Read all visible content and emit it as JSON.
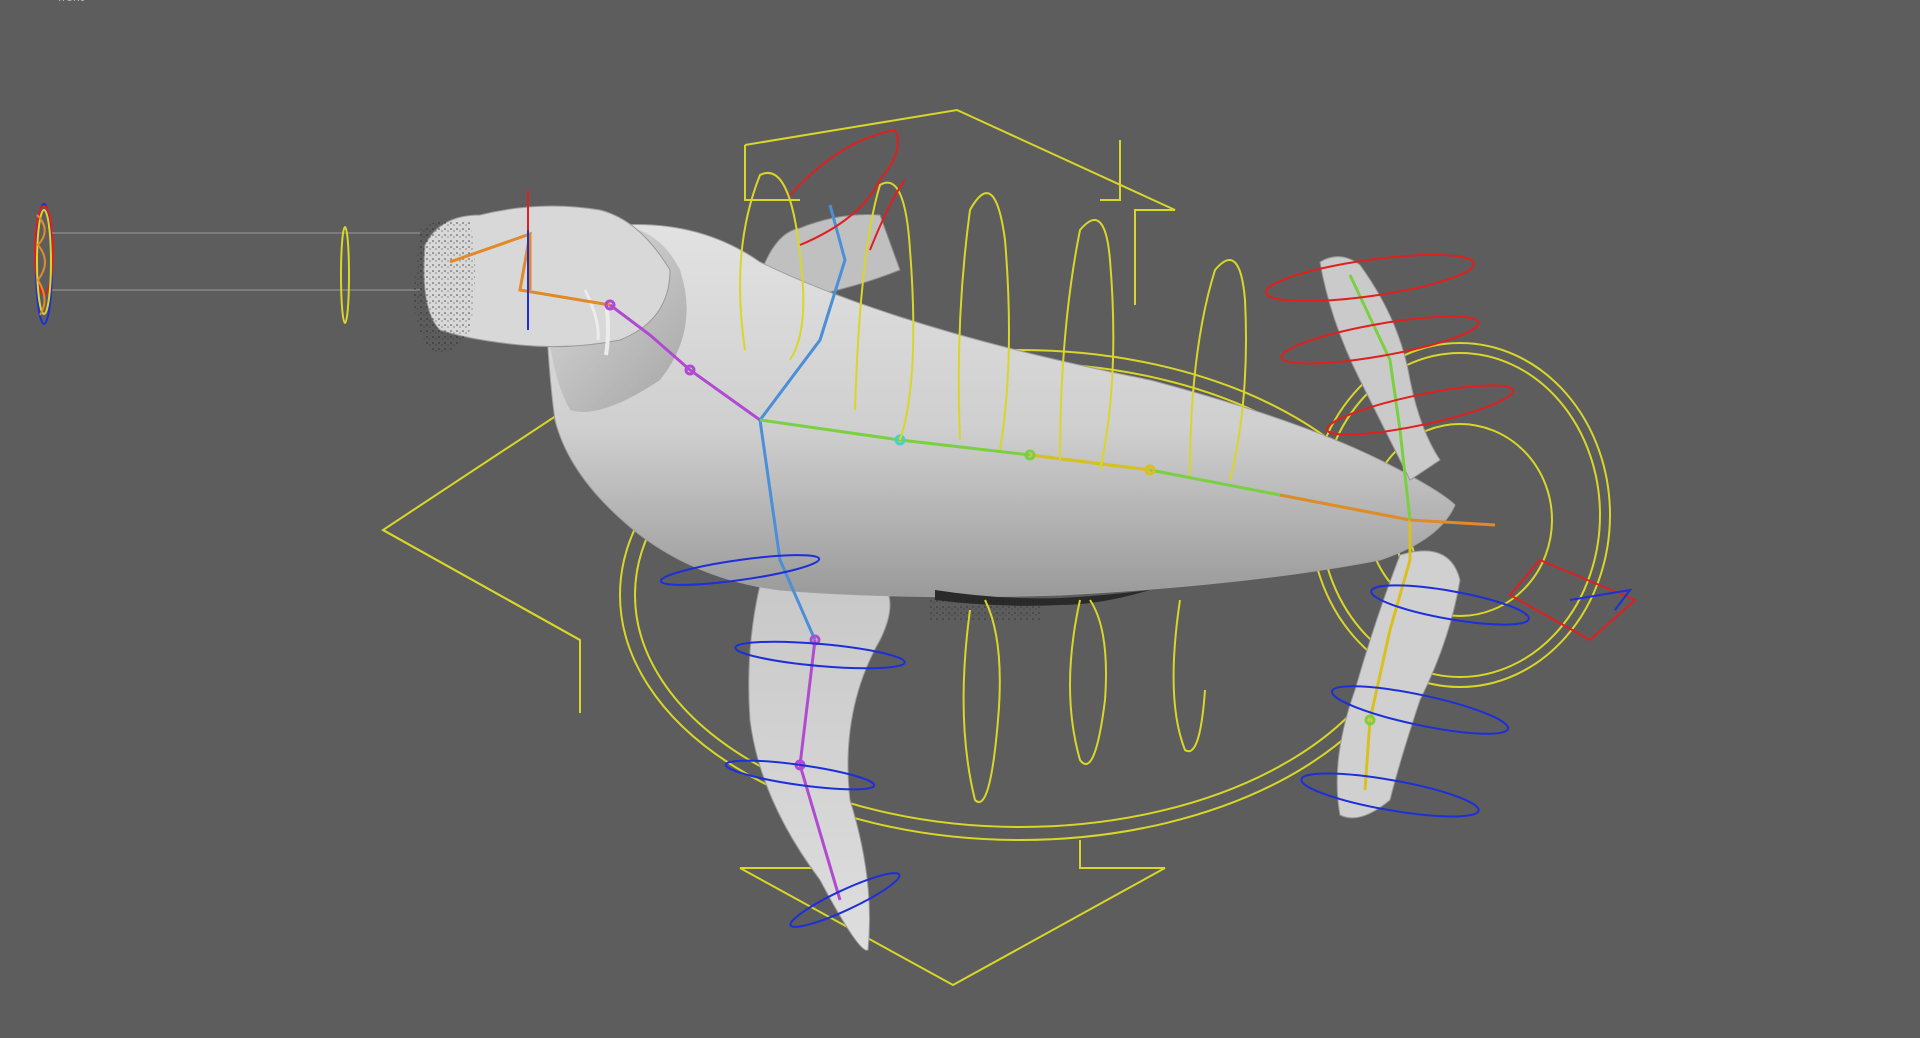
{
  "viewport": {
    "label": "front",
    "background": "#5d5d5d"
  },
  "colors": {
    "control_curve": "#d9d62a",
    "x_axis_ring": "#e01f1f",
    "z_axis_ring": "#1c2fd8",
    "mesh_light": "#d2d2d2",
    "mesh_dark": "#8a8a8a",
    "joint_orange": "#e08a2a",
    "joint_blue": "#4a8fd8",
    "joint_purple": "#b04ad0",
    "joint_green": "#7ad040",
    "joint_yellow": "#e0c020"
  },
  "icons": {
    "locator": "eye-target-locator-icon",
    "master_control": "four-arrow-master-control-icon"
  }
}
